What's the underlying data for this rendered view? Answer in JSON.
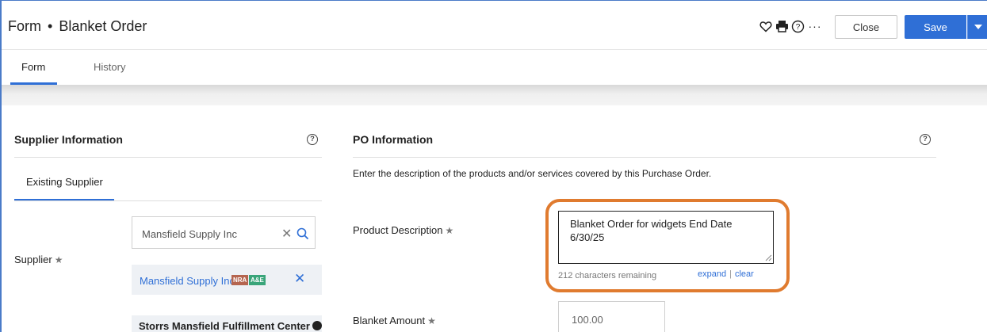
{
  "header": {
    "form_label": "Form",
    "separator": "•",
    "title": "Blanket Order",
    "icons": [
      "heart-icon",
      "print-icon",
      "help-icon",
      "more-icon"
    ],
    "more_glyph": "···",
    "close_label": "Close",
    "save_label": "Save"
  },
  "tabs": [
    {
      "label": "Form",
      "active": true
    },
    {
      "label": "History",
      "active": false
    }
  ],
  "supplier": {
    "section_title": "Supplier Information",
    "subtab": "Existing Supplier",
    "field_label": "Supplier",
    "search_value": "Mansfield Supply Inc",
    "selected_name": "Mansfield Supply Inc",
    "badges": [
      "NRA",
      "A&E"
    ],
    "address_title": "Storrs Mansfield Fulfillment Center"
  },
  "po": {
    "section_title": "PO Information",
    "description": "Enter the description of the products and/or services covered by this Purchase Order.",
    "product_label": "Product Description",
    "product_value": "Blanket Order for widgets End Date 6/30/25",
    "remaining": "212 characters remaining",
    "expand_label": "expand",
    "link_sep": "|",
    "clear_label": "clear",
    "amount_label": "Blanket Amount",
    "amount_value": "100.00"
  },
  "colors": {
    "accent": "#2f6fd6",
    "highlight": "#e07b2f"
  }
}
